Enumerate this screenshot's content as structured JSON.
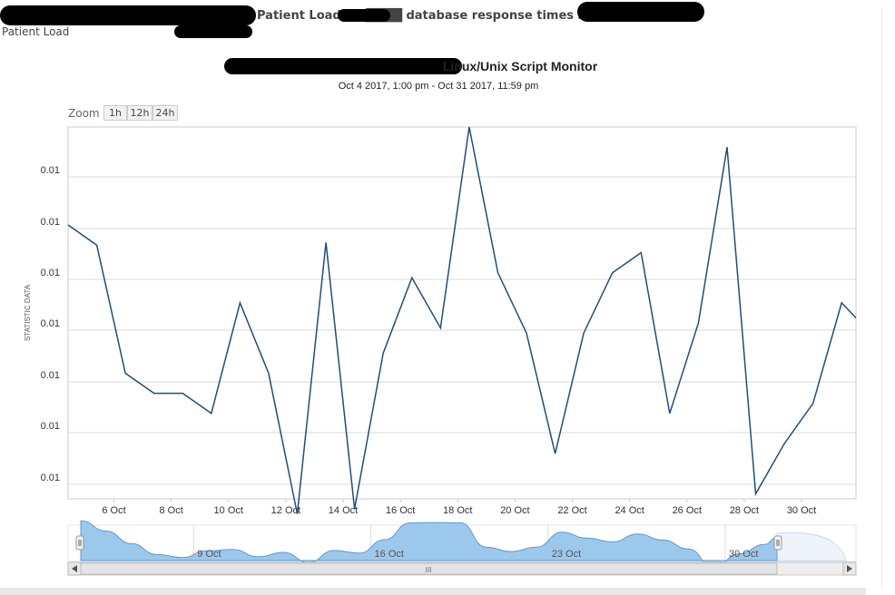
{
  "header": {
    "title_fragment": "Patient Load on ████ database response times script on",
    "subtitle": "Patient Load"
  },
  "chart_header": {
    "title": "Linux/Unix Script Monitor",
    "subtitle": "Oct 4 2017, 1:00 pm - Oct 31 2017, 11:59 pm"
  },
  "zoom": {
    "label": "Zoom",
    "buttons": [
      "1h",
      "12h",
      "24h"
    ]
  },
  "chart_data": {
    "type": "line",
    "title": "Linux/Unix Script Monitor",
    "subtitle": "Oct 4 2017, 1:00 pm - Oct 31 2017, 11:59 pm",
    "ylabel": "STATISTIC DATA",
    "xlabel": "",
    "y_tick_labels": [
      "0.01",
      "0.01",
      "0.01",
      "0.01",
      "0.01",
      "0.01",
      "0.01"
    ],
    "x_tick_labels": [
      "6 Oct",
      "8 Oct",
      "10 Oct",
      "12 Oct",
      "14 Oct",
      "16 Oct",
      "18 Oct",
      "20 Oct",
      "22 Oct",
      "24 Oct",
      "26 Oct",
      "28 Oct",
      "30 Oct"
    ],
    "x_range_days": [
      4.4,
      31.9
    ],
    "y_range": [
      0.0058,
      0.0132
    ],
    "grid": true,
    "series_color": "#1f4e79",
    "series": [
      {
        "x": [
          4.4,
          5.4,
          6.4,
          7.4,
          8.4,
          9.4,
          10.4,
          11.4,
          12.4,
          13.4,
          14.4,
          15.4,
          16.4,
          17.4,
          18.4,
          19.4,
          20.4,
          21.4,
          22.4,
          23.4,
          24.4,
          25.4,
          26.4,
          27.4,
          28.4,
          29.4,
          30.4,
          31.4,
          31.9
        ],
        "y": [
          0.01125,
          0.01085,
          0.0083,
          0.0079,
          0.0079,
          0.0075,
          0.0097,
          0.0083,
          0.0055,
          0.0109,
          0.0056,
          0.0087,
          0.0102,
          0.0092,
          0.0132,
          0.0103,
          0.0091,
          0.0067,
          0.0091,
          0.0103,
          0.0107,
          0.0075,
          0.0093,
          0.0128,
          0.0059,
          0.0069,
          0.0077,
          0.0097,
          0.0094
        ]
      }
    ]
  },
  "navigator": {
    "labels": [
      "9 Oct",
      "16 Oct",
      "23 Oct",
      "30 Oct"
    ],
    "scrollbar_grip": "III",
    "fill_color": "#9cc8ec",
    "line_color": "#5b9bd5"
  }
}
